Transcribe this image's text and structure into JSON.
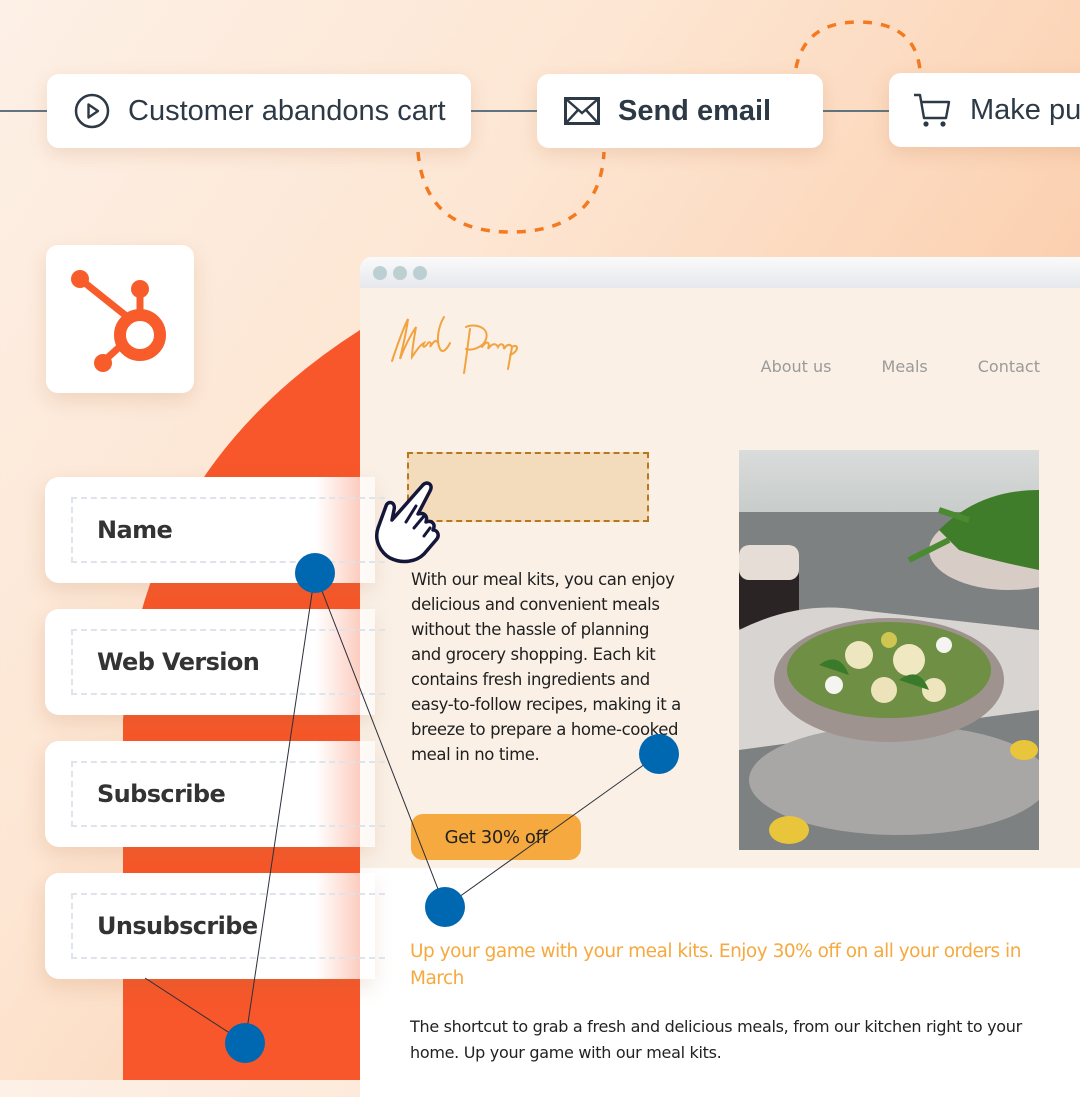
{
  "workflow": {
    "steps": [
      {
        "label": "Customer abandons cart",
        "icon": "play-circle-icon"
      },
      {
        "label": "Send email",
        "icon": "envelope-icon"
      },
      {
        "label": "Make pu",
        "icon": "shopping-cart-icon"
      }
    ]
  },
  "brand": {
    "logo": "hubspot-sprocket-icon",
    "accent": "#f95c2b",
    "node_color": "#0067b1",
    "dash_color": "#f47a1f"
  },
  "fields": [
    {
      "label": "Name"
    },
    {
      "label": "Web Version"
    },
    {
      "label": "Subscribe"
    },
    {
      "label": "Unsubscribe"
    }
  ],
  "browser": {
    "logo_text": "Meal Prep",
    "nav": [
      "About us",
      "Meals",
      "Contact"
    ],
    "body_text": "With our meal kits, you can enjoy delicious and convenient meals without the hassle of planning and grocery shopping. Each kit contains fresh ingredients and easy-to-follow recipes, making it a breeze to prepare a home-cooked meal in no time.",
    "cta_label": "Get 30% off",
    "image_alt": "Salad bowl with melon, feta, arugula and grapes",
    "headline": "Up your game with your meal kits. Enjoy 30% off on all your orders in March",
    "subtext": "The shortcut to grab a fresh and delicious meals, from our kitchen right to your home. Up your game with our meal kits."
  }
}
